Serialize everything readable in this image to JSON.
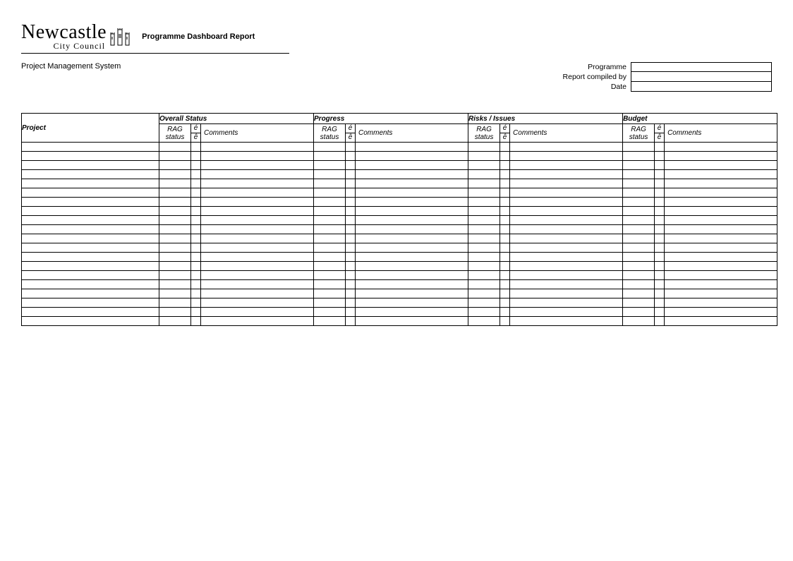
{
  "logo": {
    "wordmark": "Newcastle",
    "subtext": "City Council"
  },
  "report_title": "Programme Dashboard Report",
  "system_name": "Project Management System",
  "meta": {
    "programme_label": "Programme",
    "programme_value": "",
    "compiled_label": "Report compiled by",
    "compiled_value": "",
    "date_label": "Date",
    "date_value": ""
  },
  "table": {
    "project_header": "Project",
    "groups": [
      "Overall Status",
      "Progress",
      "Risks / Issues",
      "Budget"
    ],
    "sub": {
      "rag": "RAG status",
      "arrow_up": "é",
      "arrow_down": "ê",
      "comments": "Comments"
    },
    "row_count": 20
  }
}
